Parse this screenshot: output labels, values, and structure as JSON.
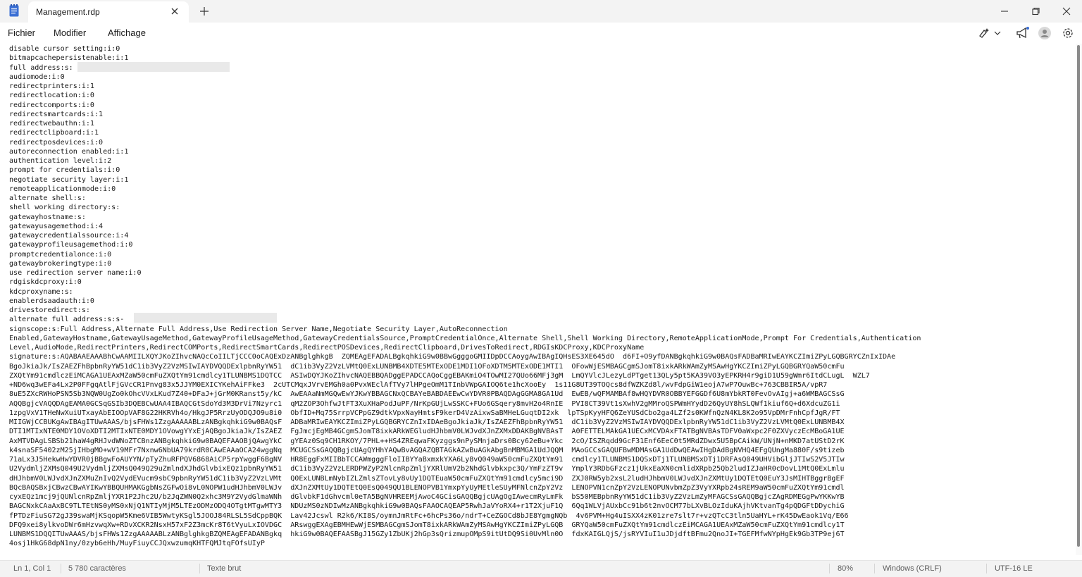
{
  "tab": {
    "title": "Management.rdp"
  },
  "menu": {
    "file": "Fichier",
    "edit": "Modifier",
    "view": "Affichage"
  },
  "content": {
    "lines": [
      "disable cursor setting:i:0",
      "bitmapcachepersistenable:i:1",
      "full address:s:",
      "audiomode:i:0",
      "redirectprinters:i:1",
      "redirectlocation:i:0",
      "redirectcomports:i:0",
      "redirectsmartcards:i:1",
      "redirectwebauthn:i:1",
      "redirectclipboard:i:1",
      "redirectposdevices:i:0",
      "autoreconnection enabled:i:1",
      "authentication level:i:2",
      "prompt for credentials:i:0",
      "negotiate security layer:i:1",
      "remoteapplicationmode:i:0",
      "alternate shell:s:",
      "shell working directory:s:",
      "gatewayhostname:s:",
      "gatewayusagemethod:i:4",
      "gatewaycredentialssource:i:4",
      "gatewayprofileusagemethod:i:0",
      "promptcredentialonce:i:0",
      "gatewaybrokeringtype:i:0",
      "use redirection server name:i:0",
      "rdgiskdcproxy:i:0",
      "kdcproxyname:s:",
      "enablerdsaadauth:i:0",
      "drivestoredirect:s:",
      "alternate full address:s:s-",
      "signscope:s:Full Address,Alternate Full Address,Use Redirection Server Name,Negotiate Security Layer,AutoReconnection",
      "Enabled,GatewayHostname,GatewayUsageMethod,GatewayProfileUsageMethod,GatewayCredentialsSource,PromptCredentialOnce,Alternate Shell,Shell Working Directory,RemoteApplicationMode,Prompt For Credentials,Authentication",
      "Level,AudioMode,RedirectPrinters,RedirectCOMPorts,RedirectSmartCards,RedirectPOSDevices,RedirectClipboard,DrivesToRedirect,RDGIsKDCProxy,KDCProxyName",
      "signature:s:AQABAAEAAABhCwAAMIILXQYJKoZIhvcNAQcCoIILTjCCC0oCAQExDzANBglghkgB  ZQMEAgEFADALBgkqhkiG9w0BBwGgggoGMIIDpDCCAoygAwIBAgIQHsES3XE645dO  d6FI+O9yfDANBgkqhkiG9w0BAQsFADBaMRIwEAYKCZImiZPyLGQBGRYCZnIxIDAe",
      "BgoJkiaJk/IsZAEZFhBpbnRyYW51dC1ib3VyZ2VzMSIwIAYDVQQDExlpbnRyYW51  dC1ib3VyZ2VzLVMtQ0ExLUNBMB4XDTE5MTExODE1MDI1OFoXDTM5MTExODE1MTI1  OFowWjESMBAGCgmSJomT8ixkARkWAmZyMSAwHgYKCZImiZPyLGQBGRYQaW50cmFu",
      "ZXQtYm91cmdlczEiMCAGA1UEAxMZaW50cmFuZXQtYm91cmdlcy1TLUNBMS1DQTCC  ASIwDQYJKoZIhvcNAQEBBQADggEPADCCAQoCggEBAKmiO4TOwMI27QUo66MFj3gM  LmQYVlcJLezyLdPTget13QLy5pt5KA39VO3yEPKRH4r9giD1U59gWmr6ItdCLugL  WZL7",
      "+ND6wq3wEFa4Lx2P0FFgqAtlFjGVcCR1Pnvg83x5JJYM0EXICYKehAiFFke3  2cUTCMqxJVrvEMGh0a0PvxWEclAfTVy7lHPgeOmM1TInbVWpGAIOQ6te1hcXooEy  1s11G8UT39TOQcs8dfWZKZd8l/wvFdpGiW1eojA7wP7OuwBc+763CBBIR5A/vpR7",
      "8uE5ZXcRWHoPSN5Sb3NQW0UgZo0kOhcVVxLKud7Z40+DFaJ+jGrM0KRanst5y/kC  AwEAAaNmMGQwEwYJKwYBBAGCNxQCBAYeBABDAEEwCwYDVR0PBAQDAgGGMA8GA1Ud  EwEB/wQFMAMBAf8wHQYDVR0OBBYEFGGDf6U8mYbkRT0FevOvAIgj+a6WMBAGCSsG",
      "AQQBgjcVAQQDAgEAMA0GCSqGSIb3DQEBCwUAA4IBAQCGtSdoYd3M3DrVi7Nzyrc1  qM2ZOP3OhfwJtFT3XuXHaPodJuPF/NrKpGUjLwSSKC+FUo6GSqery8mvH2o4RnIE  PVI8CT39Vt1sXwhV2gMMroQSPWmHYydD26QyUY8hSLQWf1kiuf6Q+d6XdcuZG1i",
      "1zpgVxV1THeNwXuiUTxayAbEIOOpVAF8G22HKRVh4o/HkgJP5RrzUyODQJO9u8i0  ObfID+Mq75SrrpVCPpGZ9dtkVpxNayHmtsF9kerD4VzAixwSaBMHeLGuqtDI2xk  lpTSpKyyHFQ6ZeYUSdCbo2ga4LZf2s0KWfnQzN4KL8K2o95VpDMrFnhCpfJgR/FT",
      "MIIGWjCCBUKgAwIBAgITUwAAAS/bjsFHWs1ZzgAAAAABLzANBgkqhkiG9w0BAQsF  ADBaMRIwEAYKCZImiZPyLGQBGRYCZnIxIDAeBgoJkiaJk/IsZAEZFhBpbnRyYW51  dC1ib3VyZ2VzMSIwIAYDVQQDExlpbnRyYW51dC1ib3VyZ2VzLVMtQ0ExLUNBMB4X",
      "DTI1MTIxNTE0MDY1OVoXDTI2MTIxNTE0MDY1OVowgYYxEjAQBgoJkiaJk/IsZAEZ  FgJmcjEgMB4GCgmSJomT8ixkARkWEGludHJhbmV0LWJvdXJnZXMxDDAKBgNVBAsT  A0FETTELMAkGA1UECxMCVDAxFTATBgNVBAsTDFV0aWxpc2F0ZXVyczEcMBoGA1UE",
      "AxMTVDAgLSBSb21haW4gRHJvdWNoZTCBnzANBgkqhkiG9w0BAQEFAAOBjQAwgYkC  gYEAz0Sq9CH1RKOY/7PHL++HS4ZREqwaFKyzggs9nPySMnjaDrs0Bcy62eBu+Ykc  2cO/ISZRqdd9GcF31Enf6EeC0t5MRdZDwx5U5BpCAikW/UNjN+nMKD7atUStD2rK",
      "k4snaSF5402zM25jIHbgMO+wV19MFr7Nxnw6NbUA79krdR0CAwEAAaOCA24wggNq  MCUGCSsGAQQBgjcUAgQYHhYAQwBvAGQAZQBTAGkAZwBuAGkAbgBnMBMGA1UdJQQM  MAoGCCsGAQUFBwMDMAsGA1UdDwQEAwIHgDAdBgNVHQ4EFgQUngMa880F/s9tizeb",
      "71aLx3J5HekwHwYDVR0jBBgwFoAUYYN/pTyZhuRFPQV6868AiCP5rpYwggF6BgNV  HR8EggFxMIIBbTCCAWmgggFloIIBYYaBxmxkYXA6Ly8vQ049aW50cmFuZXQtYm91  cmdlcy1TLUNBMS1DQSxDTj1TLUNBMSxDTj1DRFAsQ049UHVibGljJTIwS2V5JTIw",
      "U2VydmljZXMsQ049U2VydmljZXMsQ049Q29uZmlndXJhdGlvbixEQz1pbnRyYW51  dC1ib3VyZ2VzLERDPWZyP2NlcnRpZmljYXRlUmV2b2NhdGlvbkxpc3Q/YmFzZT9v  YmplY3RDbGFzcz1jUkxEaXN0cmlidXRpb25Qb2ludIZJaHR0cDovL1MtQ0ExLmlu",
      "dHJhbmV0LWJvdXJnZXMuZnIvQ2VydEVucm9sbC9pbnRyYW51dC1ib3VyZ2VzLVMt  Q0ExLUNBLmNybIZLZmlsZTovLy8vUy1DQTEuaW50cmFuZXQtYm91cmdlcy5mci9D  ZXJ0RW5yb2xsL2ludHJhbmV0LWJvdXJnZXMtUy1DQTEtQ0EuY3JsMIHTBggrBgEF",
      "BQcBAQSBxjCBwzCBwAYIKwYBBQUHMAKGgbNsZGFwOi8vL0NOPW1udHJhbmV0LWJv  dXJnZXMtUy1DQTEtQ0EsQ049QU1BLENOPVB1YmxpYyUyMEtleSUyMFNlcnZpY2Vz  LENOPVN1cnZpY2VzLENOPUNvbmZpZ3VyYXRpb24sREM9aW50cmFuZXQtYm91cmdl",
      "cyxEQz1mcj9jQUNlcnRpZmljYXR1P2Jhc2U/b2JqZWN0Q2xhc3M9Y2VydGlmaWNh  dGlvbkF1dGhvcml0eTA5BgNVHREEMjAwoC4GCisGAQQBgjcUAgOgIAwecmRyLmFk  bS50MEBpbnRyYW51dC1ib3VyZ2VzLmZyMFAGCSsGAQQBgjcZAgRDMEGgPwYKKwYB",
      "BAGCNxkCAaAxBC9TLTEtNS0yMS0xNjQ1NTIyMjM5LTEzODMzODQ4OTgtMTgwMTY3  NDUzMS0zNDIwMzANBgkqhkiG9w0BAQsFAAOCAQEAP5RwhJaVYoRX4+r1T2XjuF1Q  6Qq1WLVjAUxbCc91b6t2nvOCM77bLXvBLOzIduKAjhVKtvanTg4pQDGFtDDychiG",
      "fPTDzFiuSG72gJ39swaMjKSqopW5Kme6VIB5WwtyKSgl5JOOJ84RLSL5SdCppBQK  Lav42Jcswl R2k6/KI8S/oymnJmRtFc+6hcPs36o/ndrT+CeZGOCd8bJE8YgmgNQb  4v6PVM+Hg4uISXX4zK01zre7slt7r+vzQTcC3tln5UaHYL+rK45DwEaok1Vq/E66",
      "DFQ9xei8ylkvoDWr6mHzvwqXw+RDvXCKR2NsxH57xF2Z3mcKr8T6tVyuLxIOVDGC  ARswggEXAgEBMHEwWjESMBAGCgmSJomT8ixkARkWAmZyMSAwHgYKCZImiZPyLGQB  GRYQaW50cmFuZXQtYm91cmdlczEiMCAGA1UEAxMZaW50cmFuZXQtYm91cmdlcy1T",
      "LUNBMS1DQQITUwAAAS/bjsFHWs1ZzgAAAAABLzANBglghkgBZQMEAgEFADANBgkq  hkiG9w0BAQEFAASBgJ15GZy1ZbUKj2hGp3sQrizmupOMpS9itUtDQ9Si0UvMln0O  fdxKAIGLQjS/jsRYVIuI1uJDjdftBFmu2QnoJI+TGEFMfwNYpHgEk9Gb3TP9ej6T",
      "4osj1HkG68dpN1ny/0zyb6eHh/MuyFiuyCCJQxwzumqKHTFQMJtqFOfsUIyP"
    ]
  },
  "status": {
    "position": "Ln 1, Col 1",
    "char_count": "5 780 caractères",
    "format": "Texte brut",
    "zoom": "80%",
    "line_ending": "Windows (CRLF)",
    "encoding": "UTF-16 LE"
  },
  "icons": {
    "app": "notepad-icon",
    "close_tab": "close-icon",
    "new_tab": "plus-icon",
    "minimize": "minimize-icon",
    "maximize": "maximize-icon",
    "close_window": "close-icon",
    "copilot": "copilot-icon",
    "dropdown": "chevron-down-icon",
    "feedback": "megaphone-icon",
    "profile": "avatar",
    "settings": "gear-icon"
  },
  "colors": {
    "titlebar": "#f3f3f3",
    "editor_bg": "#ffffff",
    "statusbar": "#f3f3f3",
    "accent": "#3b6fd4"
  }
}
